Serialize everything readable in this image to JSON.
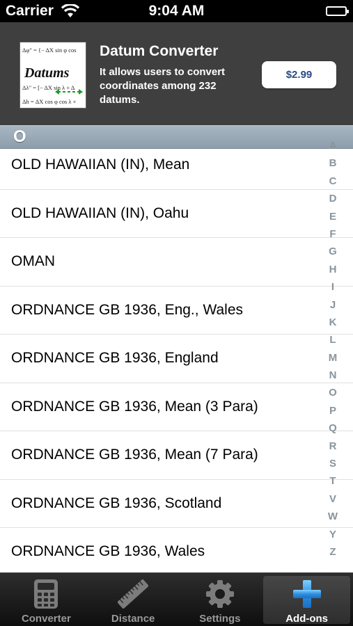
{
  "status_bar": {
    "carrier": "Carrier",
    "time": "9:04 AM"
  },
  "banner": {
    "title": "Datum Converter",
    "description": "It allows users to convert coordinates among 232 datums.",
    "price": "$2.99",
    "thumbnail": {
      "logo": "Datums",
      "eq1": "Δφ\" = {− ΔX sin φ cos",
      "eq2": "Δλ\" = [− ΔX sin λ + Δ",
      "eq3": "Δh = ΔX cos φ cos λ +"
    }
  },
  "section": {
    "letter": "O"
  },
  "datums": [
    "OLD HAWAIIAN (IN), Mean",
    "OLD HAWAIIAN (IN), Oahu",
    "OMAN",
    "ORDNANCE GB 1936, Eng., Wales",
    "ORDNANCE GB 1936, England",
    "ORDNANCE GB 1936, Mean (3 Para)",
    "ORDNANCE GB 1936, Mean (7 Para)",
    "ORDNANCE GB 1936, Scotland",
    "ORDNANCE GB 1936, Wales"
  ],
  "index_letters": [
    "A",
    "B",
    "C",
    "D",
    "E",
    "F",
    "G",
    "H",
    "I",
    "J",
    "K",
    "L",
    "M",
    "N",
    "O",
    "P",
    "Q",
    "R",
    "S",
    "T",
    "V",
    "W",
    "Y",
    "Z"
  ],
  "tabs": [
    {
      "label": "Converter",
      "icon": "calculator-icon",
      "active": false
    },
    {
      "label": "Distance",
      "icon": "ruler-icon",
      "active": false
    },
    {
      "label": "Settings",
      "icon": "gear-icon",
      "active": false
    },
    {
      "label": "Add-ons",
      "icon": "plus-icon",
      "active": true
    }
  ],
  "colors": {
    "tab_active_icon": "#2f8fe0",
    "index_text": "#8a949c",
    "price_text": "#2a4a82"
  }
}
